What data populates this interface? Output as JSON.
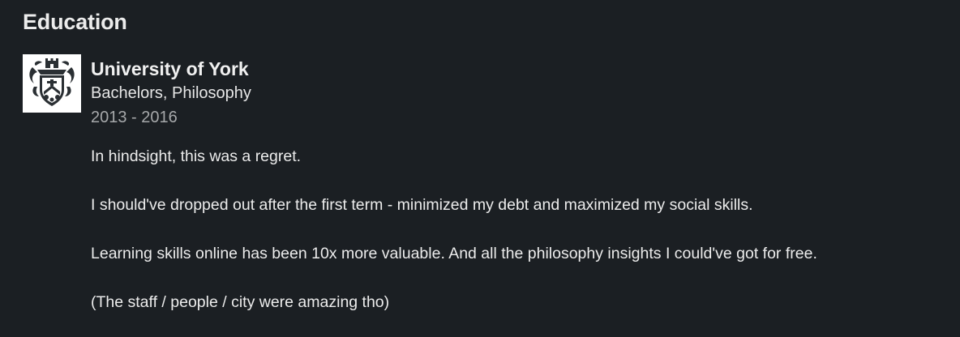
{
  "section": {
    "title": "Education"
  },
  "education": {
    "school": "University of York",
    "degree": "Bachelors, Philosophy",
    "dates": "2013 - 2016",
    "logo_icon": "university-crest-icon",
    "description": [
      "In hindsight, this was a regret.",
      "I should've dropped out after the first term - minimized my debt and maximized my social skills.",
      "Learning skills online has been 10x more valuable. And all the philosophy insights I could've got for free.",
      "(The staff / people / city were amazing tho)"
    ]
  },
  "colors": {
    "background": "#1b1f23",
    "text": "#e9e9e9",
    "muted": "#a6a8aa",
    "logo_bg": "#ffffff"
  }
}
